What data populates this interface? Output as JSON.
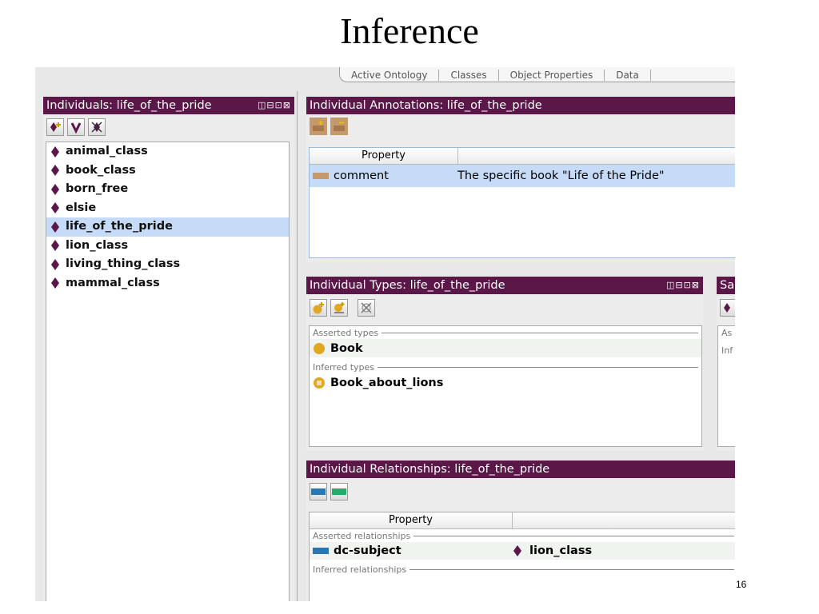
{
  "slide": {
    "title": "Inference",
    "page_number": "16"
  },
  "tabs": [
    "Active Ontology",
    "Classes",
    "Object Properties",
    "Data"
  ],
  "individuals_panel": {
    "title": "Individuals: life_of_the_pride",
    "window_controls": "◫⊟⊡⊠",
    "items": [
      {
        "label": "animal_class",
        "selected": false
      },
      {
        "label": "book_class",
        "selected": false
      },
      {
        "label": "born_free",
        "selected": false
      },
      {
        "label": "elsie",
        "selected": false
      },
      {
        "label": "life_of_the_pride",
        "selected": true
      },
      {
        "label": "lion_class",
        "selected": false
      },
      {
        "label": "living_thing_class",
        "selected": false
      },
      {
        "label": "mammal_class",
        "selected": false
      }
    ]
  },
  "annotations_panel": {
    "title": "Individual Annotations: life_of_the_pride",
    "col_property": "Property",
    "row": {
      "property": "comment",
      "value": "The specific book \"Life of the Pride\""
    }
  },
  "types_panel": {
    "title": "Individual Types: life_of_the_pride",
    "window_controls": "◫⊟⊡⊠",
    "asserted_label": "Asserted types",
    "asserted_item": "Book",
    "inferred_label": "Inferred types",
    "inferred_item": "Book_about_lions"
  },
  "same_panel": {
    "title": "Sa",
    "asserted_label": "As",
    "inferred_label": "Inf"
  },
  "relationships_panel": {
    "title": "Individual Relationships: life_of_the_pride",
    "col_property": "Property",
    "asserted_label": "Asserted relationships",
    "row": {
      "property": "dc-subject",
      "value": "lion_class"
    },
    "inferred_label": "Inferred relationships"
  },
  "colors": {
    "header": "#5b1748",
    "selection": "#c6dbf7",
    "individual_diamond": "#5b1748",
    "class_circle": "#e0a820",
    "annotation_swatch": "#c49a6c",
    "object_property": "#2a77b5",
    "data_property": "#2aaa6a"
  },
  "icons": [
    "add-individual-icon",
    "merge-individual-icon",
    "delete-individual-icon",
    "add-annotation-icon",
    "remove-annotation-icon",
    "add-type-icon",
    "add-type-expression-icon",
    "remove-type-icon",
    "add-object-property-icon",
    "add-data-property-icon"
  ]
}
